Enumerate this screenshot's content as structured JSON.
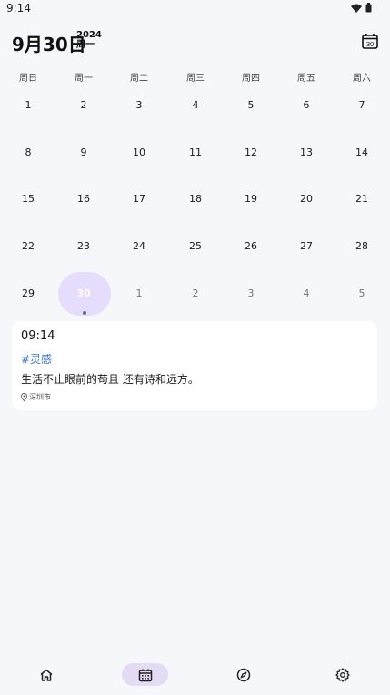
{
  "status_bar": {
    "time": "9:14",
    "icons": [
      "wifi-icon",
      "battery-icon"
    ]
  },
  "header": {
    "date": "9月30日",
    "year": "2024",
    "weekday": "周一",
    "calendar_button_text": "30"
  },
  "calendar": {
    "weekdays": [
      "周日",
      "周一",
      "周二",
      "周三",
      "周四",
      "周五",
      "周六"
    ],
    "weeks": [
      [
        "1",
        "2",
        "3",
        "4",
        "5",
        "6",
        "7"
      ],
      [
        "8",
        "9",
        "10",
        "11",
        "12",
        "13",
        "14"
      ],
      [
        "15",
        "16",
        "17",
        "18",
        "19",
        "20",
        "21"
      ],
      [
        "22",
        "23",
        "24",
        "25",
        "26",
        "27",
        "28"
      ],
      [
        "29",
        "30",
        "1",
        "2",
        "3",
        "4",
        "5"
      ]
    ],
    "selected_day": "30",
    "accent_color": "#e6dcfb"
  },
  "entry": {
    "time": "09:14",
    "tag": "#灵感",
    "text": "生活不止眼前的苟且 还有诗和远方。",
    "location": "深圳市",
    "tag_color": "#3a72c4"
  },
  "bottom_nav": {
    "items": [
      "home-icon",
      "calendar-icon",
      "compass-icon",
      "settings-icon"
    ],
    "active": "calendar-icon",
    "active_color": "#e4dcf5"
  }
}
